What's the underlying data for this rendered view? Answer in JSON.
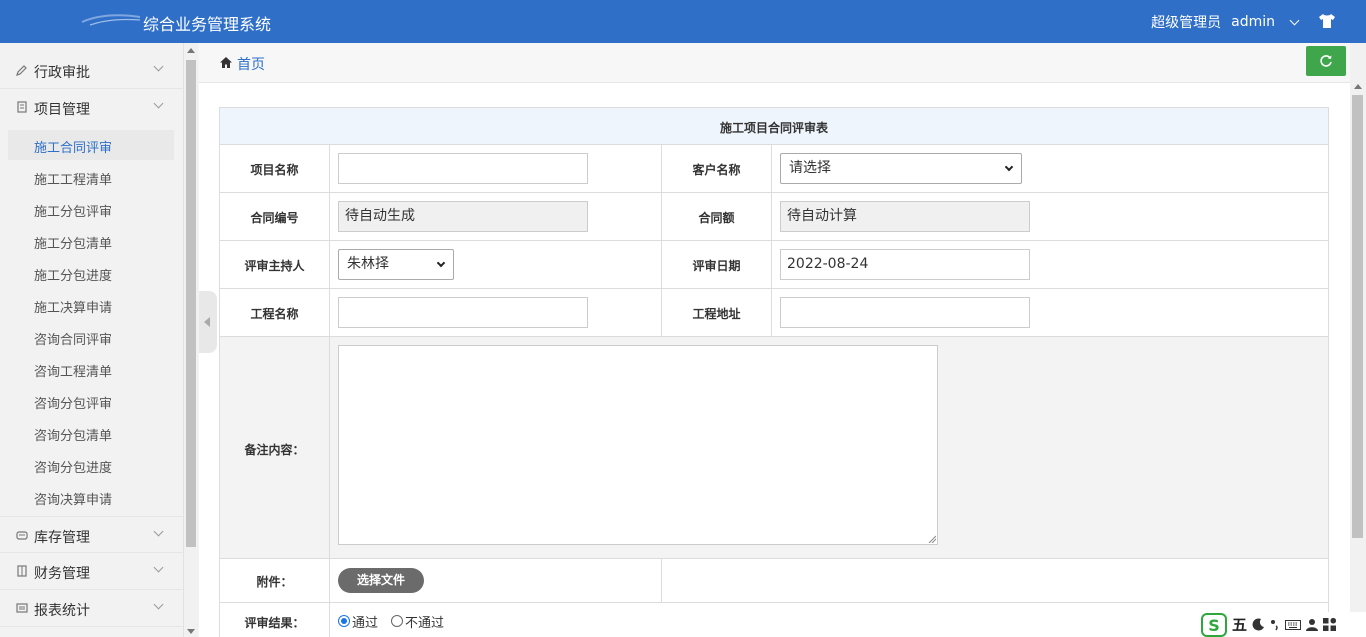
{
  "header": {
    "app_title": "综合业务管理系统",
    "user_role": "超级管理员",
    "username": "admin"
  },
  "sidebar": {
    "groups": [
      {
        "label": "行政审批",
        "icon": "pencil-icon"
      },
      {
        "label": "项目管理",
        "icon": "file-icon"
      },
      {
        "label": "库存管理",
        "icon": "warehouse-icon"
      },
      {
        "label": "财务管理",
        "icon": "ledger-icon"
      },
      {
        "label": "报表统计",
        "icon": "report-icon"
      }
    ],
    "project_items": [
      "施工合同评审",
      "施工工程清单",
      "施工分包评审",
      "施工分包清单",
      "施工分包进度",
      "施工决算申请",
      "咨询合同评审",
      "咨询工程清单",
      "咨询分包评审",
      "咨询分包清单",
      "咨询分包进度",
      "咨询决算申请"
    ],
    "active_item": "施工合同评审"
  },
  "breadcrumb": {
    "home": "首页"
  },
  "form": {
    "title": "施工项目合同评审表",
    "project_name_label": "项目名称",
    "project_name_value": "",
    "client_name_label": "客户名称",
    "client_name_selected": "请选择",
    "contract_no_label": "合同编号",
    "contract_no_value": "待自动生成",
    "contract_amount_label": "合同额",
    "contract_amount_value": "待自动计算",
    "host_label": "评审主持人",
    "host_selected": "朱林择",
    "review_date_label": "评审日期",
    "review_date_value": "2022-08-24",
    "engineering_name_label": "工程名称",
    "engineering_name_value": "",
    "engineering_address_label": "工程地址",
    "engineering_address_value": "",
    "remarks_label": "备注内容：",
    "attachment_label": "附件：",
    "choose_file_label": "选择文件",
    "result_label": "评审结果：",
    "result_options": [
      "通过",
      "不通过"
    ],
    "result_selected": "通过"
  },
  "ime": {
    "mode": "五"
  },
  "colors": {
    "header_bg": "#2f6fc8",
    "accent": "#2f6fc8",
    "refresh_green": "#3fa64b",
    "title_row_bg": "#eef5fc"
  }
}
